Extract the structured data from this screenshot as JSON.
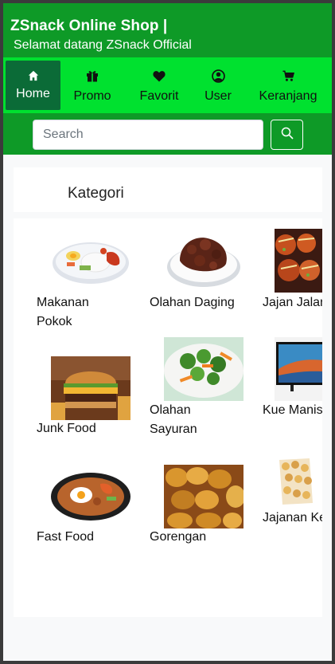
{
  "header": {
    "title": "ZSnack Online Shop |",
    "subtitle": "Selamat datang ZSnack Official"
  },
  "nav": {
    "items": [
      {
        "label": "Home",
        "icon": "home-icon",
        "active": true
      },
      {
        "label": "Promo",
        "icon": "gift-icon"
      },
      {
        "label": "Favorit",
        "icon": "heart-icon"
      },
      {
        "label": "User",
        "icon": "user-circle-icon"
      },
      {
        "label": "Keranjang",
        "icon": "cart-icon"
      }
    ]
  },
  "search": {
    "placeholder": "Search",
    "value": ""
  },
  "categories": {
    "heading": "Kategori",
    "items": [
      {
        "name": "Makanan Pokok",
        "image": "rice-plate"
      },
      {
        "name": "Olahan Daging",
        "image": "beef-dish"
      },
      {
        "name": "Jajan Jalanan",
        "image": "takoyaki"
      },
      {
        "name": "Junk Food",
        "image": "burger"
      },
      {
        "name": "Olahan Sayuran",
        "image": "vegetables"
      },
      {
        "name": "Kue Manis",
        "image": "tv-cake"
      },
      {
        "name": "Fast Food",
        "image": "fried-rice"
      },
      {
        "name": "Gorengan",
        "image": "fritters"
      },
      {
        "name": "Jajanan Kering",
        "image": "cookies-jar"
      }
    ]
  },
  "colors": {
    "header_bg": "#0e9a27",
    "nav_bg": "#00e12f",
    "active_bg": "#0b6b37"
  }
}
